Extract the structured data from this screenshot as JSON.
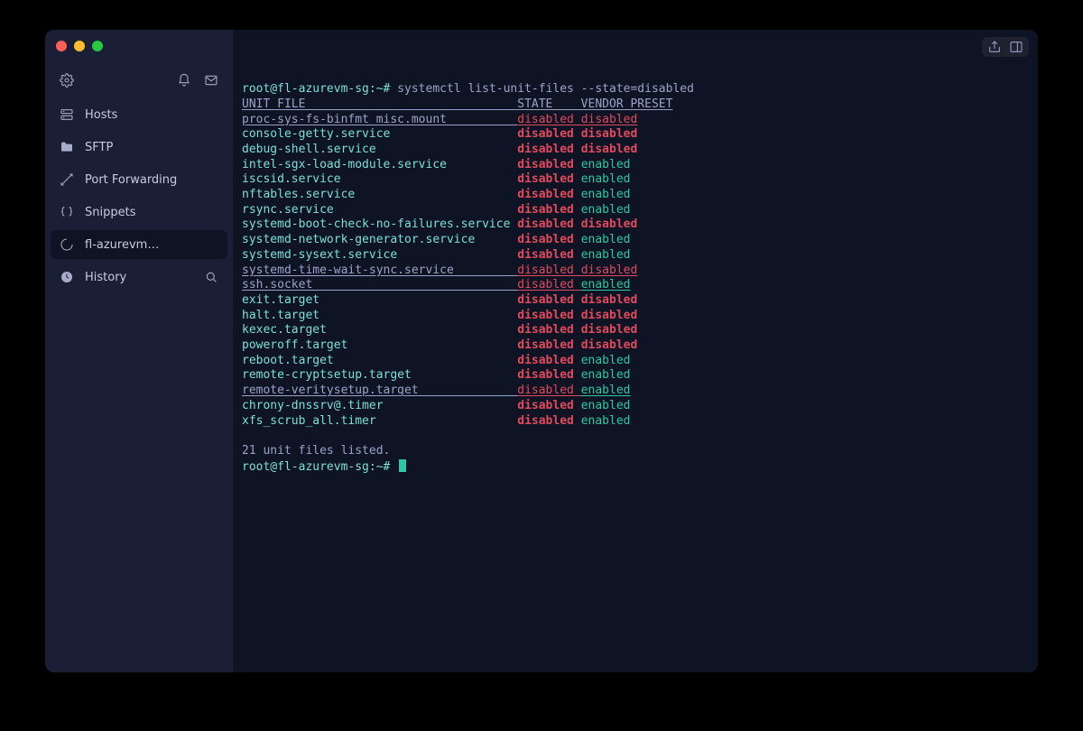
{
  "sidebar": {
    "items": [
      {
        "key": "hosts",
        "label": "Hosts",
        "icon": "server"
      },
      {
        "key": "sftp",
        "label": "SFTP",
        "icon": "folder"
      },
      {
        "key": "portfwd",
        "label": "Port Forwarding",
        "icon": "ports"
      },
      {
        "key": "snippets",
        "label": "Snippets",
        "icon": "braces"
      },
      {
        "key": "session",
        "label": "fl-azurevm…",
        "icon": "spinner",
        "active": true
      },
      {
        "key": "history",
        "label": "History",
        "icon": "clock",
        "trail": "search"
      }
    ]
  },
  "terminal": {
    "prompt": "root@fl-azurevm-sg:~#",
    "command": "systemctl list-unit-files --state=disabled",
    "header": {
      "unit": "UNIT FILE",
      "state": "STATE",
      "preset": "VENDOR PRESET"
    },
    "rows": [
      {
        "unit": "proc-sys-fs-binfmt_misc.mount",
        "state": "disabled",
        "preset": "disabled",
        "style": "link"
      },
      {
        "unit": "console-getty.service",
        "state": "disabled",
        "preset": "disabled"
      },
      {
        "unit": "debug-shell.service",
        "state": "disabled",
        "preset": "disabled"
      },
      {
        "unit": "intel-sgx-load-module.service",
        "state": "disabled",
        "preset": "enabled"
      },
      {
        "unit": "iscsid.service",
        "state": "disabled",
        "preset": "enabled"
      },
      {
        "unit": "nftables.service",
        "state": "disabled",
        "preset": "enabled"
      },
      {
        "unit": "rsync.service",
        "state": "disabled",
        "preset": "enabled"
      },
      {
        "unit": "systemd-boot-check-no-failures.service",
        "state": "disabled",
        "preset": "disabled"
      },
      {
        "unit": "systemd-network-generator.service",
        "state": "disabled",
        "preset": "enabled"
      },
      {
        "unit": "systemd-sysext.service",
        "state": "disabled",
        "preset": "enabled"
      },
      {
        "unit": "systemd-time-wait-sync.service",
        "state": "disabled",
        "preset": "disabled",
        "style": "link"
      },
      {
        "unit": "ssh.socket",
        "state": "disabled",
        "preset": "enabled",
        "style": "link"
      },
      {
        "unit": "exit.target",
        "state": "disabled",
        "preset": "disabled"
      },
      {
        "unit": "halt.target",
        "state": "disabled",
        "preset": "disabled"
      },
      {
        "unit": "kexec.target",
        "state": "disabled",
        "preset": "disabled"
      },
      {
        "unit": "poweroff.target",
        "state": "disabled",
        "preset": "disabled"
      },
      {
        "unit": "reboot.target",
        "state": "disabled",
        "preset": "enabled"
      },
      {
        "unit": "remote-cryptsetup.target",
        "state": "disabled",
        "preset": "enabled"
      },
      {
        "unit": "remote-veritysetup.target",
        "state": "disabled",
        "preset": "enabled",
        "style": "link"
      },
      {
        "unit": "chrony-dnssrv@.timer",
        "state": "disabled",
        "preset": "enabled"
      },
      {
        "unit": "xfs_scrub_all.timer",
        "state": "disabled",
        "preset": "enabled"
      }
    ],
    "footer": "21 unit files listed.",
    "widths": {
      "unit": 39,
      "state": 9
    }
  }
}
